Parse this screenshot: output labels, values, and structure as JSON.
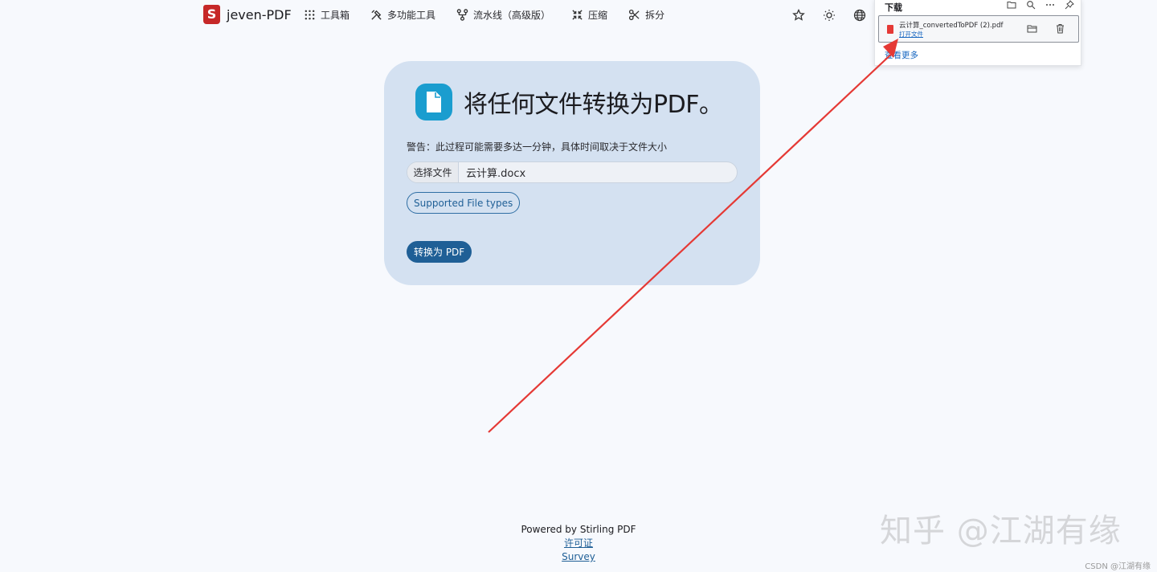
{
  "navbar": {
    "brand_logo": "S",
    "brand_name": "jeven-PDF",
    "items": [
      {
        "label": "工具箱",
        "icon": "grid-icon"
      },
      {
        "label": "多功能工具",
        "icon": "tools-icon"
      },
      {
        "label": "流水线（高级版）",
        "icon": "pipeline-icon"
      },
      {
        "label": "压缩",
        "icon": "compress-icon"
      },
      {
        "label": "拆分",
        "icon": "scissors-icon"
      }
    ],
    "right_icons": [
      "star-icon",
      "sun-icon",
      "globe-icon"
    ]
  },
  "card": {
    "icon": "document-icon",
    "title": "将任何文件转换为PDF。",
    "warning": "警告：此过程可能需要多达一分钟，具体时间取决于文件大小",
    "file_button_label": "选择文件",
    "file_name": "云计算.docx",
    "types_button": "Supported File types",
    "convert_button": "转换为 PDF"
  },
  "download_panel": {
    "title": "下载",
    "tool_icons": [
      "folder-icon",
      "search-icon",
      "more-icon",
      "pin-icon"
    ],
    "item": {
      "filename": "云计算_convertedToPDF (2).pdf",
      "open_link": "打开文件"
    },
    "see_more": "查看更多"
  },
  "footer": {
    "powered": "Powered by Stirling PDF",
    "license": "许可证",
    "survey": "Survey"
  },
  "watermarks": {
    "zhihu": "知乎 @江湖有缘",
    "csdn": "CSDN @江湖有缘"
  },
  "colors": {
    "card_bg": "#d4e1f1",
    "accent": "#1f5f96",
    "icon_badge": "#1a9dcf",
    "brand_red": "#c62828",
    "arrow": "#e53935"
  }
}
